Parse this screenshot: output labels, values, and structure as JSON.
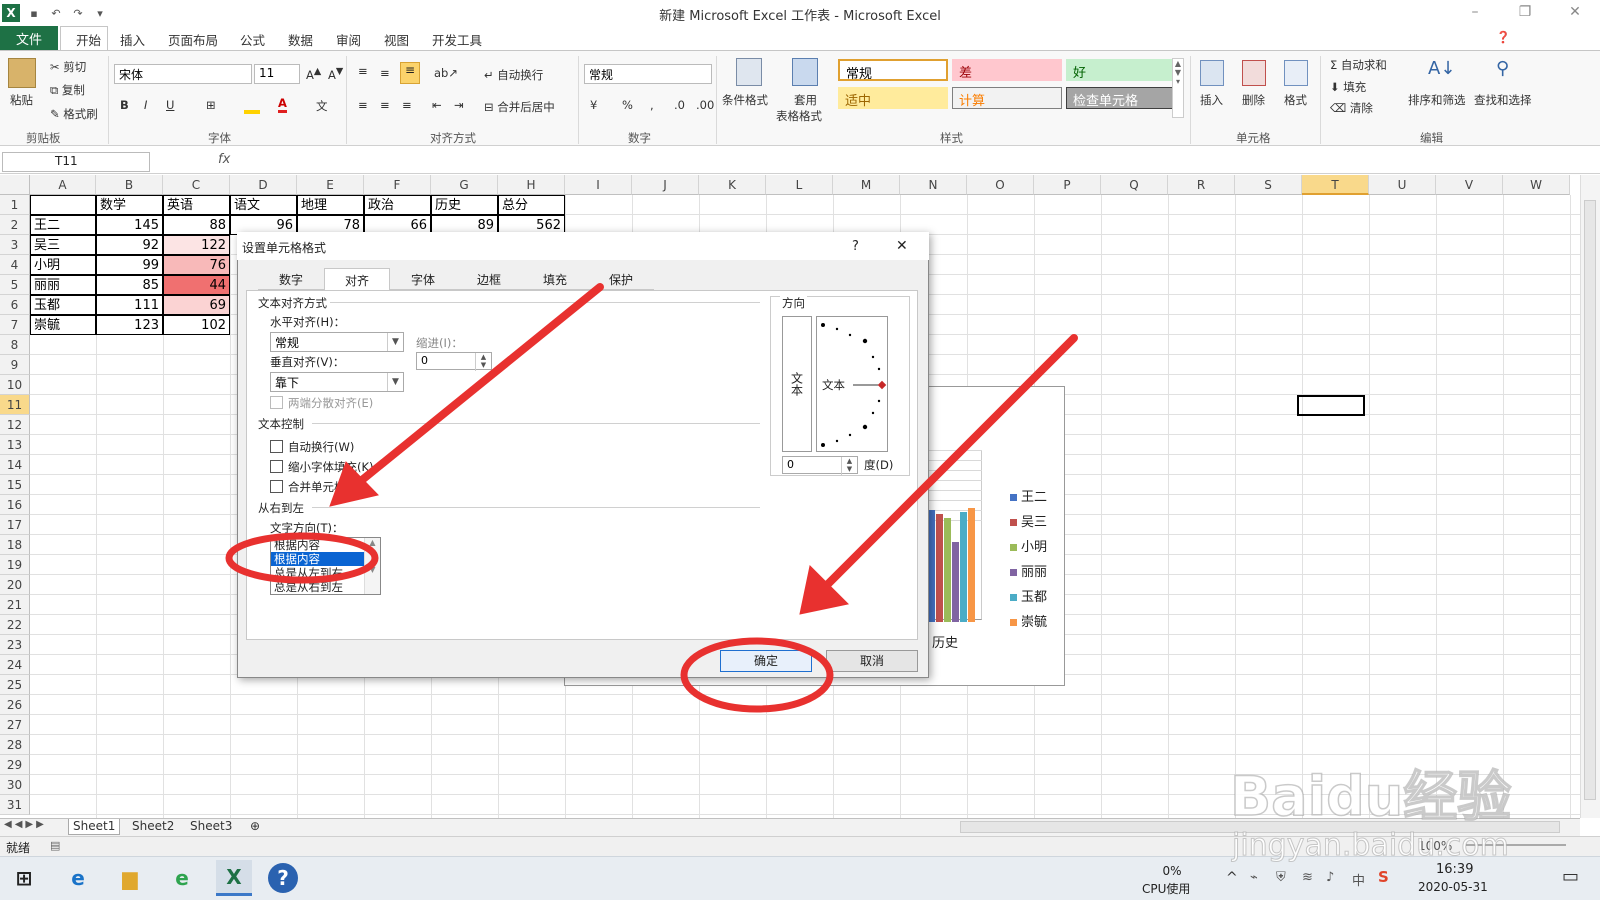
{
  "window": {
    "title": "新建 Microsoft Excel 工作表 - Microsoft Excel"
  },
  "ribbon_tabs": [
    "文件",
    "开始",
    "插入",
    "页面布局",
    "公式",
    "数据",
    "审阅",
    "视图",
    "开发工具"
  ],
  "clipboard": {
    "paste": "粘贴",
    "cut": "剪切",
    "copy": "复制",
    "format_painter": "格式刷",
    "group": "剪贴板"
  },
  "font": {
    "name": "宋体",
    "size": "11",
    "bold": "B",
    "italic": "I",
    "underline": "U",
    "group": "字体"
  },
  "alignment": {
    "wrap": "自动换行",
    "merge": "合并后居中",
    "group": "对齐方式"
  },
  "number": {
    "format": "常规",
    "percent": "%",
    "comma": ",",
    "group": "数字"
  },
  "styles": {
    "conditional": "条件格式",
    "table_line1": "套用",
    "table_line2": "表格格式",
    "cells": [
      {
        "label": "常规",
        "bg": "#ffffff",
        "color": "#000000",
        "border": "#e0a030"
      },
      {
        "label": "差",
        "bg": "#ffc7ce",
        "color": "#9c0006",
        "border": "#ffc7ce"
      },
      {
        "label": "好",
        "bg": "#c6efce",
        "color": "#006100",
        "border": "#c6efce"
      },
      {
        "label": "适中",
        "bg": "#ffeb9c",
        "color": "#9c6500",
        "border": "#ffeb9c"
      },
      {
        "label": "计算",
        "bg": "#f2f2f2",
        "color": "#fa7d00",
        "border": "#7f7f7f"
      },
      {
        "label": "检查单元格",
        "bg": "#a5a5a5",
        "color": "#ffffff",
        "border": "#3f3f3f"
      }
    ],
    "group": "样式"
  },
  "cells_group": {
    "insert": "插入",
    "delete": "删除",
    "format": "格式",
    "group": "单元格"
  },
  "editing": {
    "autosum": "自动求和",
    "fill": "填充",
    "clear": "清除",
    "sort": "排序和筛选",
    "find": "查找和选择",
    "group": "编辑"
  },
  "formula_bar": {
    "name_box": "T11",
    "fx": "fx",
    "value": ""
  },
  "columns": [
    "A",
    "B",
    "C",
    "D",
    "E",
    "F",
    "G",
    "H",
    "I",
    "J",
    "K",
    "L",
    "M",
    "N",
    "O",
    "P",
    "Q",
    "R",
    "S",
    "T",
    "U",
    "V",
    "W"
  ],
  "rows": [
    "1",
    "2",
    "3",
    "4",
    "5",
    "6",
    "7",
    "8",
    "9",
    "10",
    "11",
    "12",
    "13",
    "14",
    "15",
    "16",
    "17",
    "18",
    "19",
    "20",
    "21",
    "22",
    "23",
    "24",
    "25",
    "26",
    "27",
    "28",
    "29",
    "30",
    "31"
  ],
  "sheet": {
    "headers": [
      "",
      "数学",
      "英语",
      "语文",
      "地理",
      "政治",
      "历史",
      "总分"
    ],
    "data": [
      [
        "王二",
        "145",
        "88",
        "96",
        "78",
        "66",
        "89",
        "562"
      ],
      [
        "吴三",
        "92",
        "122"
      ],
      [
        "小明",
        "99",
        "76"
      ],
      [
        "丽丽",
        "85",
        "44"
      ],
      [
        "玉都",
        "111",
        "69"
      ],
      [
        "崇毓",
        "123",
        "102"
      ]
    ],
    "highlight_colors": [
      "#ffffff",
      "#fce4e4",
      "#f8b9b9",
      "#f07070",
      "#fbd3d3",
      "#ffffff"
    ]
  },
  "chart": {
    "category_label": "历史",
    "legend": [
      {
        "name": "王二",
        "color": "#4472c4"
      },
      {
        "name": "吴三",
        "color": "#c0504d"
      },
      {
        "name": "小明",
        "color": "#9bbb59"
      },
      {
        "name": "丽丽",
        "color": "#8064a2"
      },
      {
        "name": "玉都",
        "color": "#4bacc6"
      },
      {
        "name": "崇毓",
        "color": "#f79646"
      }
    ]
  },
  "dialog": {
    "title": "设置单元格格式",
    "help": "?",
    "close": "✕",
    "tabs": [
      "数字",
      "对齐",
      "字体",
      "边框",
      "填充",
      "保护"
    ],
    "text_alignment": "文本对齐方式",
    "horizontal_label": "水平对齐(H)：",
    "horizontal_value": "常规",
    "indent_label": "缩进(I)：",
    "indent_value": "0",
    "vertical_label": "垂直对齐(V)：",
    "vertical_value": "靠下",
    "justify_distributed": "两端分散对齐(E)",
    "text_control": "文本控制",
    "wrap_text": "自动换行(W)",
    "shrink_fit": "缩小字体填充(K)",
    "merge_cells": "合并单元格(M)",
    "rtl_section": "从右到左",
    "text_direction_label": "文字方向(T)：",
    "direction_options": [
      "根据内容",
      "根据内容",
      "总是从左到右",
      "总是从右到左"
    ],
    "orientation": "方向",
    "vertical_text": "文本",
    "orient_text": "文本",
    "degree_value": "0",
    "degree_label": "度(D)",
    "ok": "确定",
    "cancel": "取消"
  },
  "sheet_tabs": [
    "Sheet1",
    "Sheet2",
    "Sheet3"
  ],
  "status": {
    "ready": "就绪",
    "zoom": "100%"
  },
  "taskbar": {
    "cpu_percent": "0%",
    "cpu_label": "CPU使用",
    "time": "16:39",
    "date": "2020-05-31",
    "ime": "中"
  },
  "watermark": {
    "brand": "Baidu经验",
    "url": "jingyan.baidu.com"
  },
  "annotation_color": "#e8312f"
}
